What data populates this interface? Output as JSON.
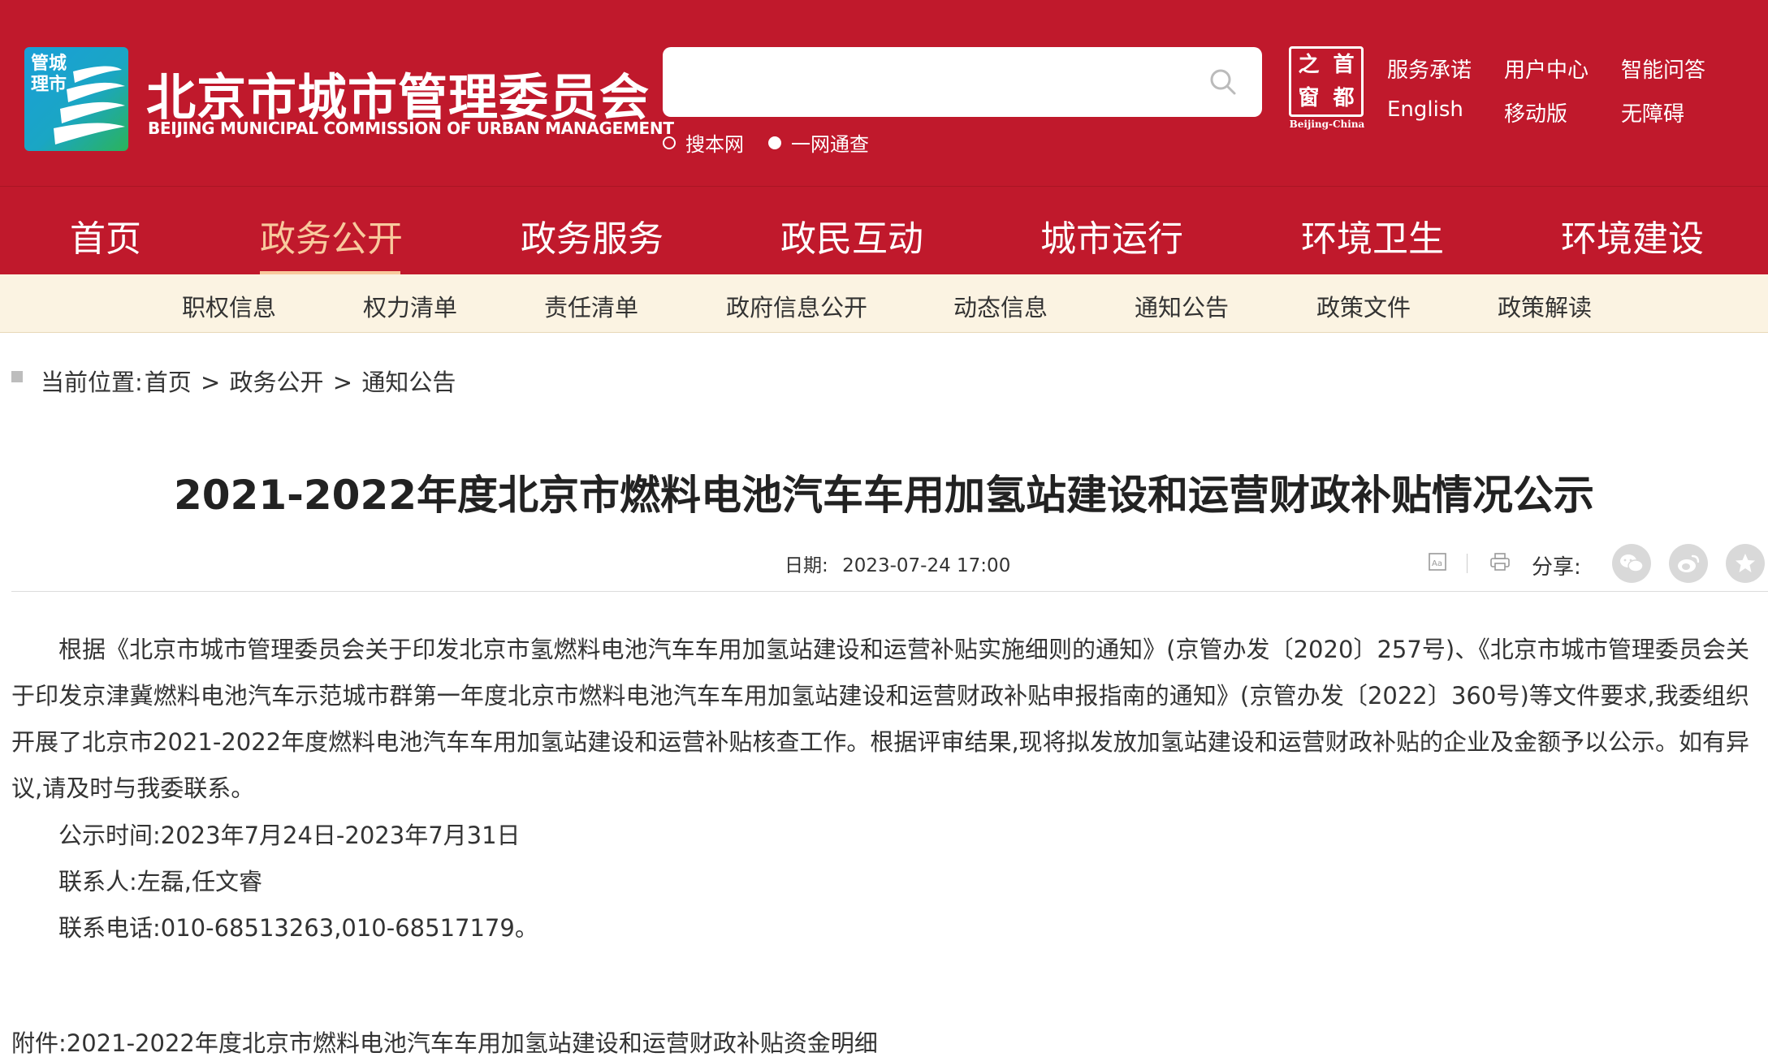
{
  "header": {
    "logo_text": "管城\n理市",
    "site_name_cn": "北京市城市管理委员会",
    "site_name_en": "BEIJING MUNICIPAL COMMISSION OF URBAN MANAGEMENT",
    "search": {
      "placeholder": "",
      "value": ""
    },
    "search_scopes": [
      {
        "label": "搜本网",
        "selected": false
      },
      {
        "label": "一网通查",
        "selected": true
      }
    ],
    "capital_seal": {
      "chars": [
        "之",
        "首",
        "窗",
        "都"
      ],
      "caption": "Beijing-China"
    },
    "top_links": [
      "服务承诺",
      "用户中心",
      "智能问答",
      "English",
      "移动版",
      "无障碍"
    ]
  },
  "main_nav": [
    {
      "label": "首页",
      "active": false
    },
    {
      "label": "政务公开",
      "active": true
    },
    {
      "label": "政务服务",
      "active": false
    },
    {
      "label": "政民互动",
      "active": false
    },
    {
      "label": "城市运行",
      "active": false
    },
    {
      "label": "环境卫生",
      "active": false
    },
    {
      "label": "环境建设",
      "active": false
    }
  ],
  "sub_nav": [
    "职权信息",
    "权力清单",
    "责任清单",
    "政府信息公开",
    "动态信息",
    "通知公告",
    "政策文件",
    "政策解读"
  ],
  "breadcrumb": {
    "prefix": "当前位置:",
    "items": [
      "首页",
      "政务公开",
      "通知公告"
    ],
    "separator": ">"
  },
  "article": {
    "title": "2021-2022年度北京市燃料电池汽车车用加氢站建设和运营财政补贴情况公示",
    "date_label": "日期:",
    "date_value": "2023-07-24 17:00",
    "share_label": "分享:",
    "body": "根据《北京市城市管理委员会关于印发北京市氢燃料电池汽车车用加氢站建设和运营补贴实施细则的通知》(京管办发〔2020〕257号)、《北京市城市管理委员会关于印发京津冀燃料电池汽车示范城市群第一年度北京市燃料电池汽车车用加氢站建设和运营财政补贴申报指南的通知》(京管办发〔2022〕360号)等文件要求,我委组织开展了北京市2021-2022年度燃料电池汽车车用加氢站建设和运营补贴核查工作。根据评审结果,现将拟发放加氢站建设和运营财政补贴的企业及金额予以公示。如有异议,请及时与我委联系。",
    "notice_period": "公示时间:2023年7月24日-2023年7月31日",
    "contacts": "联系人:左磊,任文睿",
    "phone": "联系电话:010-68513263,010-68517179。",
    "attachment": "附件:2021-2022年度北京市燃料电池汽车车用加氢站建设和运营财政补贴资金明细"
  },
  "colors": {
    "brand_red": "#c0192c",
    "nav_active": "#f8c99d",
    "subnav_bg": "#fbf3e2"
  },
  "icons": [
    "search-icon",
    "font-size-icon",
    "print-icon",
    "wechat-icon",
    "weibo-icon",
    "favorite-icon"
  ]
}
